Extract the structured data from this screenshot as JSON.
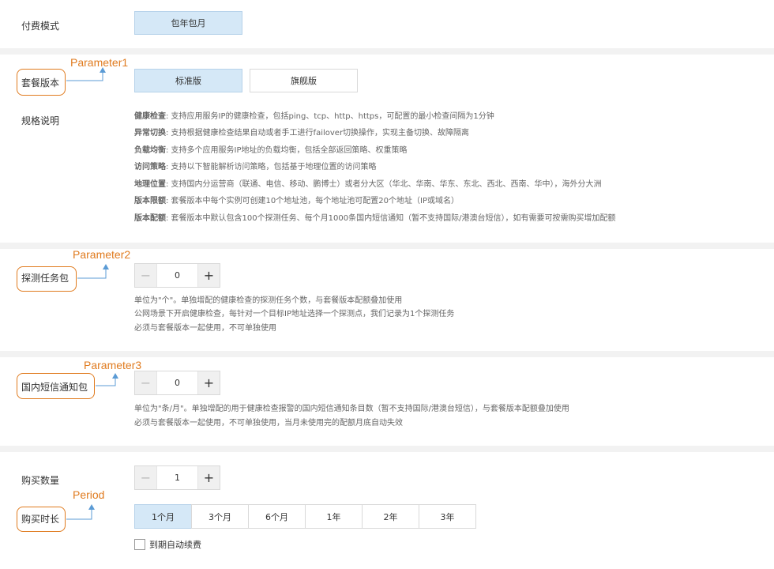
{
  "payment": {
    "label": "付费模式",
    "option": "包年包月"
  },
  "plan": {
    "label": "套餐版本",
    "options": [
      {
        "label": "标准版",
        "selected": true
      },
      {
        "label": "旗舰版",
        "selected": false
      }
    ],
    "spec_label": "规格说明",
    "specs": [
      {
        "key": "健康检查",
        "text": ": 支持应用服务IP的健康检查，包括ping、tcp、http、https，可配置的最小检查间隔为1分钟"
      },
      {
        "key": "异常切换",
        "text": ": 支持根据健康检查结果自动或者手工进行failover切换操作，实现主备切换、故障隔离"
      },
      {
        "key": "负载均衡",
        "text": ": 支持多个应用服务IP地址的负载均衡，包括全部返回策略、权重策略"
      },
      {
        "key": "访问策略",
        "text": ": 支持以下智能解析访问策略，包括基于地理位置的访问策略"
      },
      {
        "key": "地理位置",
        "text": ": 支持国内分运营商（联通、电信、移动、鹏博士）或者分大区（华北、华南、华东、东北、西北、西南、华中），海外分大洲"
      },
      {
        "key": "版本限额",
        "text": ": 套餐版本中每个实例可创建10个地址池，每个地址池可配置20个地址（IP或域名）"
      },
      {
        "key": "版本配额",
        "text": ": 套餐版本中默认包含100个探测任务、每个月1000条国内短信通知（暂不支持国际/港澳台短信），如有需要可按需购买增加配额"
      }
    ]
  },
  "probe": {
    "label": "探测任务包",
    "minus": "−",
    "plus": "+",
    "value": "0",
    "desc": [
      "单位为\"个\"。单独增配的健康检查的探测任务个数，与套餐版本配额叠加使用",
      "公网场景下开启健康检查，每针对一个目标IP地址选择一个探测点，我们记录为1个探测任务",
      "必须与套餐版本一起使用，不可单独使用"
    ]
  },
  "sms": {
    "label": "国内短信通知包",
    "minus": "−",
    "plus": "+",
    "value": "0",
    "desc": [
      "单位为\"条/月\"。单独增配的用于健康检查报警的国内短信通知条目数（暂不支持国际/港澳台短信），与套餐版本配额叠加使用",
      "必须与套餐版本一起使用，不可单独使用，当月未使用完的配额月底自动失效"
    ]
  },
  "buy": {
    "qty_label": "购买数量",
    "minus": "−",
    "plus": "+",
    "qty_value": "1",
    "period_label": "购买时长",
    "periods": [
      {
        "label": "1个月",
        "selected": true
      },
      {
        "label": "3个月",
        "selected": false
      },
      {
        "label": "6个月",
        "selected": false
      },
      {
        "label": "1年",
        "selected": false
      },
      {
        "label": "2年",
        "selected": false
      },
      {
        "label": "3年",
        "selected": false
      }
    ],
    "auto_renew_label": "到期自动续费",
    "auto_renew_checked": false
  },
  "annotations": {
    "p1": "Parameter1",
    "p2": "Parameter2",
    "p3": "Parameter3",
    "period": "Period",
    "color": "#e07b1f"
  }
}
